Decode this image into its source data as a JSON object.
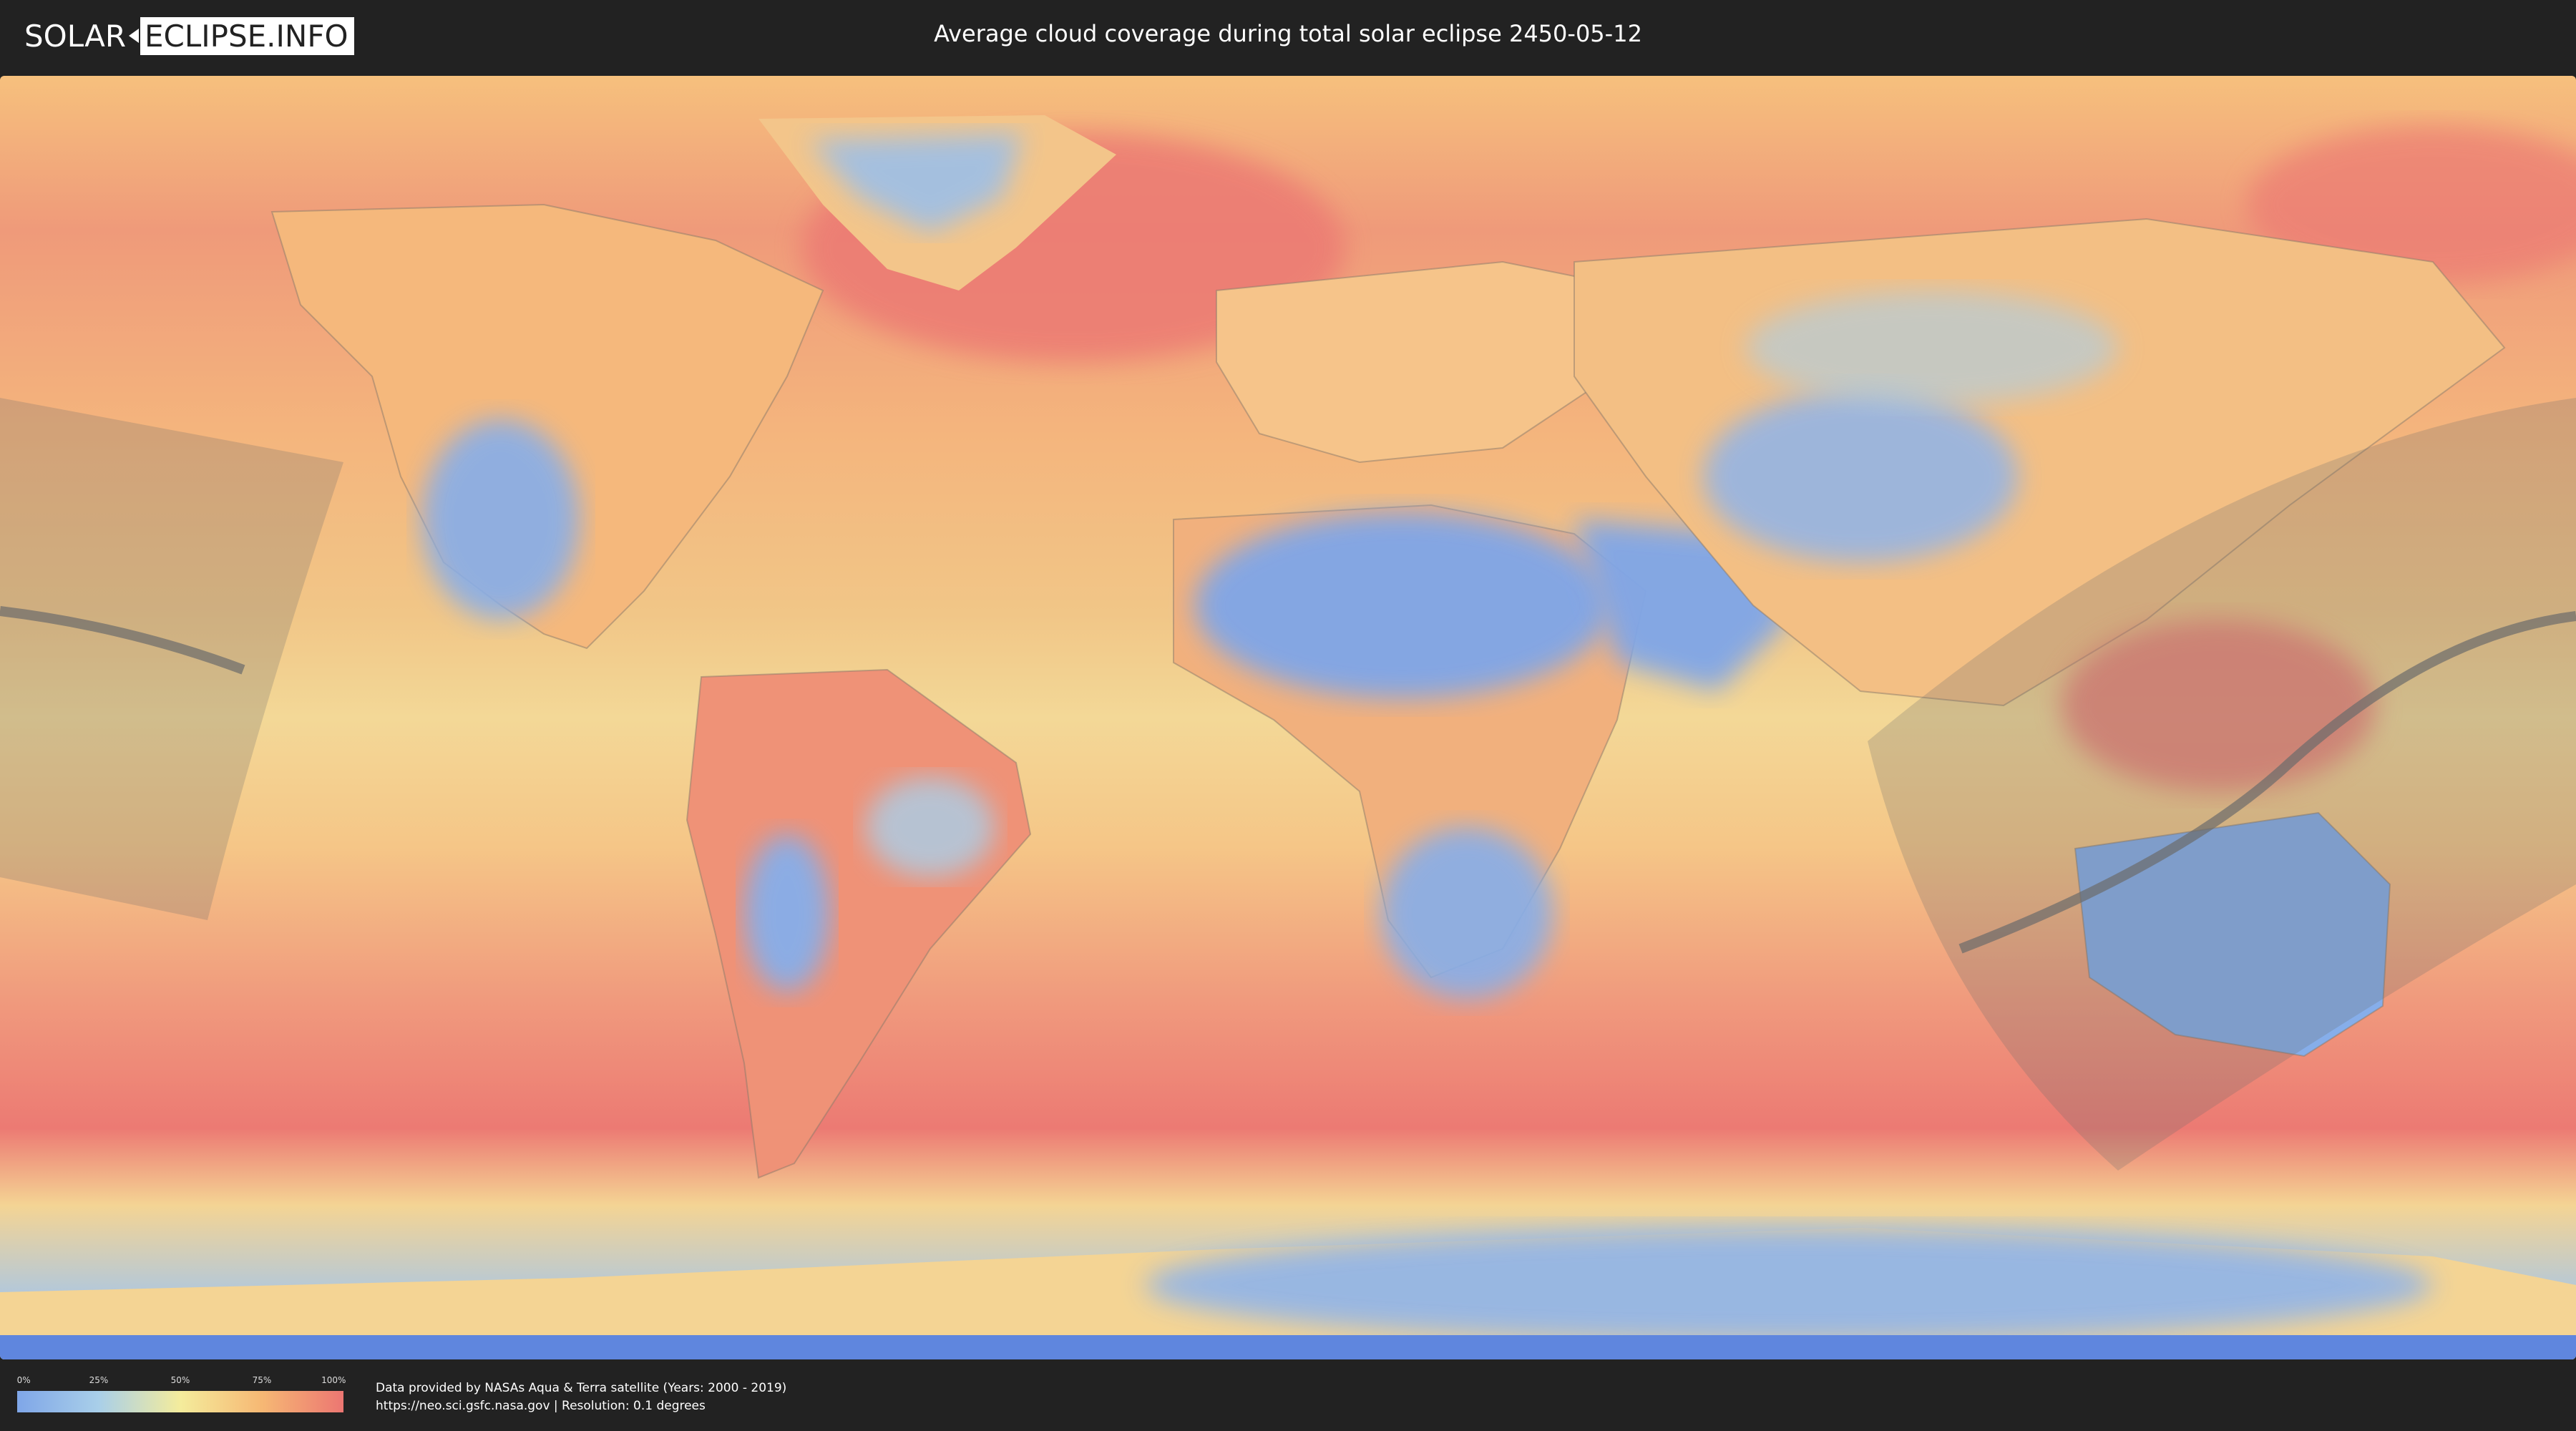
{
  "header": {
    "logo_part1": "SOLAR",
    "logo_part2": "ECLIPSE.INFO",
    "title": "Average cloud coverage during total solar eclipse 2450-05-12"
  },
  "legend": {
    "ticks": [
      "0%",
      "25%",
      "50%",
      "75%",
      "100%"
    ],
    "colors": [
      "#7fa6e8",
      "#a9cfe9",
      "#f4ec9c",
      "#f6b874",
      "#ec7672"
    ]
  },
  "credits": {
    "line1": "Data provided by NASAs Aqua & Terra satellite (Years: 2000 - 2019)",
    "line2": "https://neo.sci.gsfc.nasa.gov | Resolution: 0.1 degrees"
  },
  "map": {
    "ocean_color": "#f2a77a",
    "desert_color": "#7fa6e8",
    "eclipse_band_color": "#6b6b6b"
  }
}
